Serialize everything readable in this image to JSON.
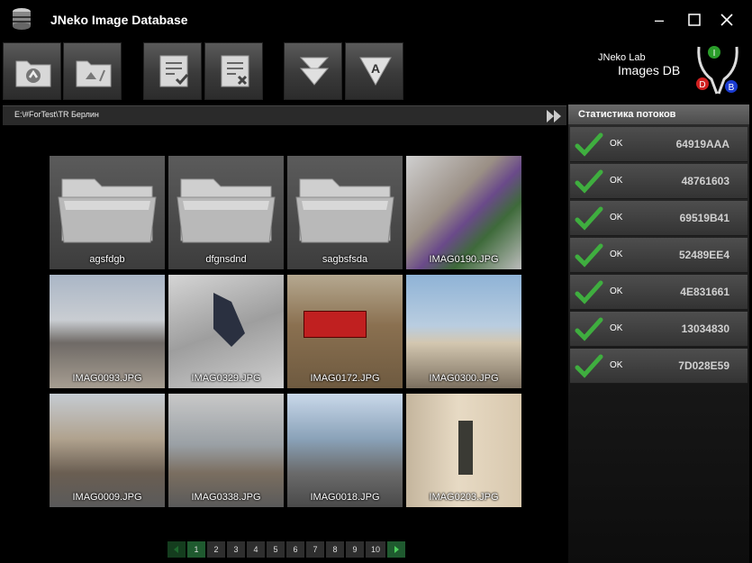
{
  "window": {
    "title": "JNeko Image Database"
  },
  "logo": {
    "lab": "JNeko Lab",
    "name": "Images DB",
    "letter_i": "I",
    "letter_d": "D",
    "letter_b": "B"
  },
  "toolbar": {
    "buttons": [
      {
        "icon": "folder-up-icon"
      },
      {
        "icon": "folder-root-icon"
      },
      {
        "icon": "checklist-select-icon"
      },
      {
        "icon": "checklist-remove-icon"
      },
      {
        "icon": "arrow-down-icon"
      },
      {
        "icon": "sort-alpha-icon",
        "letter": "A"
      }
    ]
  },
  "path": {
    "value": "E:\\#ForTest\\TR Берлин"
  },
  "grid": {
    "items": [
      {
        "type": "folder",
        "label": "agsfdgb"
      },
      {
        "type": "folder",
        "label": "dfgnsdnd"
      },
      {
        "type": "folder",
        "label": "sagbsfsda"
      },
      {
        "type": "image",
        "label": "IMAG0190.JPG"
      },
      {
        "type": "image",
        "label": "IMAG0093.JPG"
      },
      {
        "type": "image",
        "label": "IMAG0329.JPG"
      },
      {
        "type": "image",
        "label": "IMAG0172.JPG"
      },
      {
        "type": "image",
        "label": "IMAG0300.JPG"
      },
      {
        "type": "image",
        "label": "IMAG0009.JPG"
      },
      {
        "type": "image",
        "label": "IMAG0338.JPG"
      },
      {
        "type": "image",
        "label": "IMAG0018.JPG"
      },
      {
        "type": "image",
        "label": "IMAG0203.JPG"
      }
    ]
  },
  "pager": {
    "pages": [
      "1",
      "2",
      "3",
      "4",
      "5",
      "6",
      "7",
      "8",
      "9",
      "10"
    ],
    "current": "1"
  },
  "streams": {
    "title": "Статистика потоков",
    "rows": [
      {
        "status": "OK",
        "id": "64919AAA"
      },
      {
        "status": "OK",
        "id": "48761603"
      },
      {
        "status": "OK",
        "id": "69519B41"
      },
      {
        "status": "OK",
        "id": "52489EE4"
      },
      {
        "status": "OK",
        "id": "4E831661"
      },
      {
        "status": "OK",
        "id": "13034830"
      },
      {
        "status": "OK",
        "id": "7D028E59"
      }
    ]
  }
}
